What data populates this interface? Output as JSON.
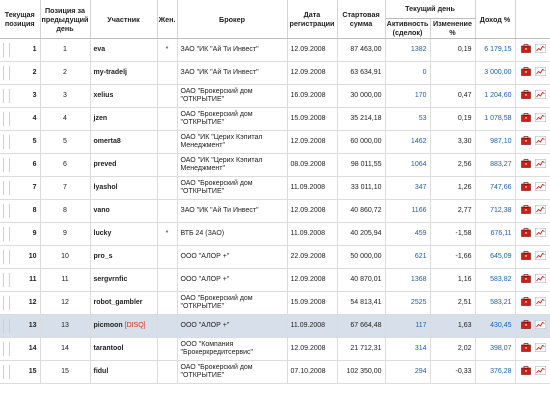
{
  "headers": {
    "position": "Текущая позиция",
    "prev_position": "Позиция за предыдущий день",
    "participant": "Участник",
    "female": "Жен.",
    "broker": "Брокер",
    "reg_date": "Дата регистрации",
    "start_sum": "Стартовая сумма",
    "current_day": "Текущий день",
    "activity": "Активность (сделок)",
    "change": "Изменение %",
    "income": "Доход %"
  },
  "rows": [
    {
      "pos": "1",
      "prev": "1",
      "name": "eva",
      "disq": "",
      "female": "*",
      "broker": "ЗАО \"ИК \"Ай Ти Инвест\"",
      "date": "12.09.2008",
      "start": "87 463,00",
      "activity": "1382",
      "change": "0,19",
      "income": "6 179,15",
      "highlight": false
    },
    {
      "pos": "2",
      "prev": "2",
      "name": "my-tradelj",
      "disq": "",
      "female": "",
      "broker": "ЗАО \"ИК \"Ай Ти Инвест\"",
      "date": "12.09.2008",
      "start": "63 634,91",
      "activity": "0",
      "change": "",
      "income": "3 000,00",
      "highlight": false
    },
    {
      "pos": "3",
      "prev": "3",
      "name": "xelius",
      "disq": "",
      "female": "",
      "broker": "ОАО \"Брокерский дом \"ОТКРЫТИЕ\"",
      "date": "16.09.2008",
      "start": "30 000,00",
      "activity": "170",
      "change": "0,47",
      "income": "1 204,60",
      "highlight": false
    },
    {
      "pos": "4",
      "prev": "4",
      "name": "jzen",
      "disq": "",
      "female": "",
      "broker": "ОАО \"Брокерский дом \"ОТКРЫТИЕ\"",
      "date": "15.09.2008",
      "start": "35 214,18",
      "activity": "53",
      "change": "0,19",
      "income": "1 078,58",
      "highlight": false
    },
    {
      "pos": "5",
      "prev": "5",
      "name": "omerta8",
      "disq": "",
      "female": "",
      "broker": "ОАО \"ИК \"Церих Кэпитал Менеджмент\"",
      "date": "12.09.2008",
      "start": "60 000,00",
      "activity": "1462",
      "change": "3,30",
      "income": "987,10",
      "highlight": false
    },
    {
      "pos": "6",
      "prev": "6",
      "name": "preved",
      "disq": "",
      "female": "",
      "broker": "ОАО \"ИК \"Церих Кэпитал Менеджмент\"",
      "date": "08.09.2008",
      "start": "98 011,55",
      "activity": "1064",
      "change": "2,56",
      "income": "883,27",
      "highlight": false
    },
    {
      "pos": "7",
      "prev": "7",
      "name": "lyashol",
      "disq": "",
      "female": "",
      "broker": "ОАО \"Брокерский дом \"ОТКРЫТИЕ\"",
      "date": "11.09.2008",
      "start": "33 011,10",
      "activity": "347",
      "change": "1,26",
      "income": "747,66",
      "highlight": false
    },
    {
      "pos": "8",
      "prev": "8",
      "name": "vano",
      "disq": "",
      "female": "",
      "broker": "ЗАО \"ИК \"Ай Ти Инвест\"",
      "date": "12.09.2008",
      "start": "40 860,72",
      "activity": "1166",
      "change": "2,77",
      "income": "712,38",
      "highlight": false
    },
    {
      "pos": "9",
      "prev": "9",
      "name": "lucky",
      "disq": "",
      "female": "*",
      "broker": "ВТБ 24 (ЗАО)",
      "date": "11.09.2008",
      "start": "40 205,94",
      "activity": "459",
      "change": "-1,58",
      "income": "676,11",
      "highlight": false
    },
    {
      "pos": "10",
      "prev": "10",
      "name": "pro_s",
      "disq": "",
      "female": "",
      "broker": "ООО \"АЛОР +\"",
      "date": "22.09.2008",
      "start": "50 000,00",
      "activity": "621",
      "change": "-1,66",
      "income": "645,09",
      "highlight": false
    },
    {
      "pos": "11",
      "prev": "11",
      "name": "sergvrnfic",
      "disq": "",
      "female": "",
      "broker": "ООО \"АЛОР +\"",
      "date": "12.09.2008",
      "start": "40 870,01",
      "activity": "1368",
      "change": "1,16",
      "income": "583,82",
      "highlight": false
    },
    {
      "pos": "12",
      "prev": "12",
      "name": "robot_gambler",
      "disq": "",
      "female": "",
      "broker": "ОАО \"Брокерский дом \"ОТКРЫТИЕ\"",
      "date": "15.09.2008",
      "start": "54 813,41",
      "activity": "2525",
      "change": "2,51",
      "income": "583,21",
      "highlight": false
    },
    {
      "pos": "13",
      "prev": "13",
      "name": "picmoon",
      "disq": "[DISQ]",
      "female": "",
      "broker": "ООО \"АЛОР +\"",
      "date": "11.09.2008",
      "start": "67 664,48",
      "activity": "117",
      "change": "1,63",
      "income": "430,45",
      "highlight": true
    },
    {
      "pos": "14",
      "prev": "14",
      "name": "tarantool",
      "disq": "",
      "female": "",
      "broker": "ООО \"Компания \"Брокеркредитсервис\"",
      "date": "12.09.2008",
      "start": "21 712,31",
      "activity": "314",
      "change": "2,02",
      "income": "398,07",
      "highlight": false
    },
    {
      "pos": "15",
      "prev": "15",
      "name": "fidul",
      "disq": "",
      "female": "",
      "broker": "ОАО \"Брокерский дом \"ОТКРЫТИЕ\"",
      "date": "07.10.2008",
      "start": "102 350,00",
      "activity": "294",
      "change": "-0,33",
      "income": "376,28",
      "highlight": false
    }
  ],
  "icons": {
    "portfolio": "portfolio-icon",
    "chart": "chart-icon"
  },
  "colors": {
    "link": "#1f5fa8",
    "disq": "#d0301a",
    "highlight_row": "#d7e0ea",
    "icon_red": "#c8201a"
  }
}
